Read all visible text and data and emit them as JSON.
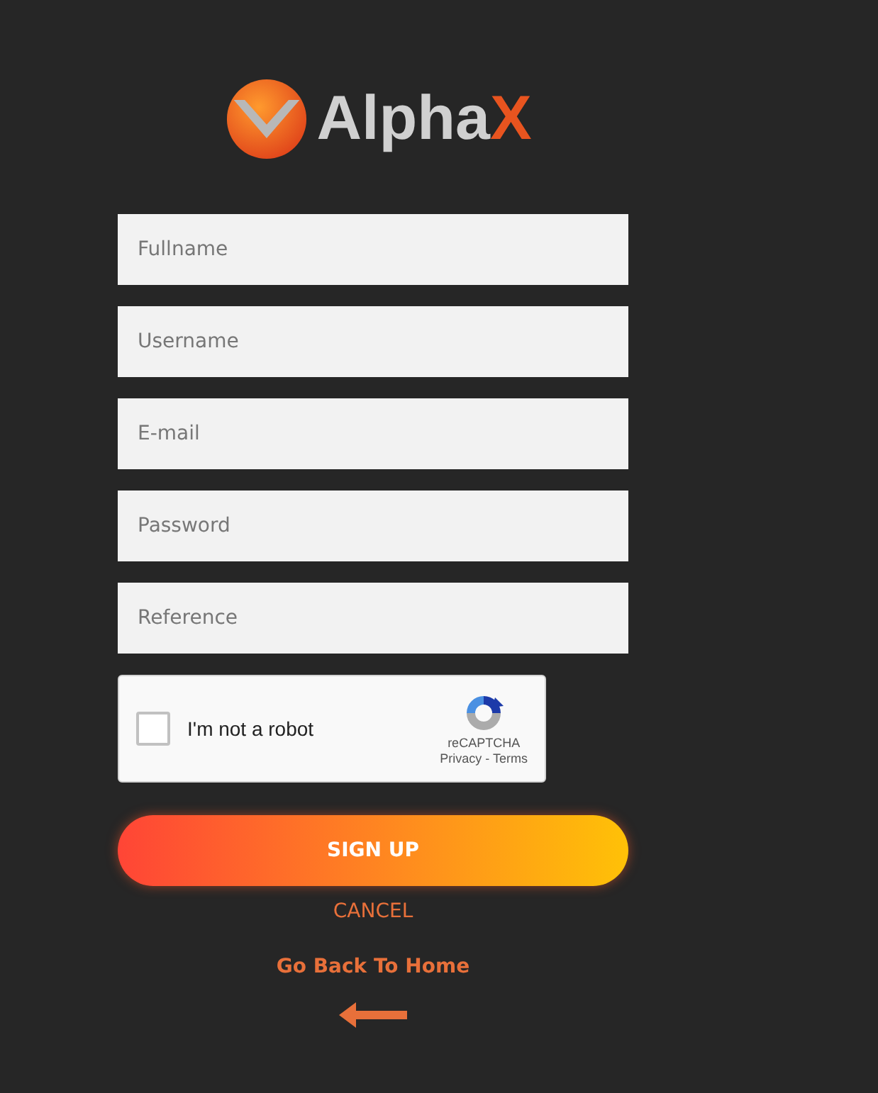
{
  "logo": {
    "text": "Alpha",
    "accent": "X"
  },
  "fields": [
    {
      "placeholder": "Fullname"
    },
    {
      "placeholder": "Username"
    },
    {
      "placeholder": "E-mail"
    },
    {
      "placeholder": "Password"
    },
    {
      "placeholder": "Reference"
    }
  ],
  "captcha": {
    "label": "I'm not a robot",
    "checked": false,
    "brand": "reCAPTCHA",
    "privacy": "Privacy",
    "separator": " - ",
    "terms": "Terms"
  },
  "submit": "SIGN UP",
  "cancel": "CANCEL",
  "home_link": "Go Back To Home"
}
